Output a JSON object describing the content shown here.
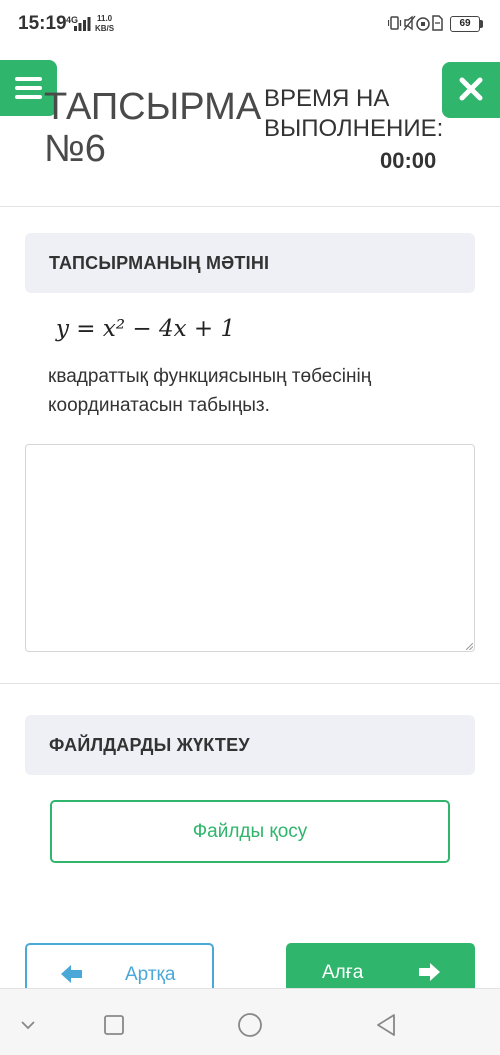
{
  "status_bar": {
    "time": "15:19",
    "network_type": "4G",
    "speed_value": "11.0",
    "speed_unit": "KB/S",
    "battery": "69",
    "icons": [
      "vibrate-icon",
      "mute-icon",
      "alarm-icon",
      "sim-icon"
    ]
  },
  "header": {
    "menu_icon": "hamburger-menu-icon",
    "close_icon": "close-icon",
    "task_title": "ТАПСЫРМА №6",
    "time_label": "ВРЕМЯ НА ВЫПОЛНЕНИЕ:",
    "time_value": "00:00"
  },
  "task": {
    "header": "ТАПСЫРМАНЫҢ МӘТІНІ",
    "formula": "y = x² − 4x + 1",
    "text": " квадраттық функциясының төбесінің координатасын табыңыз."
  },
  "answer": {
    "value": "",
    "placeholder": ""
  },
  "files": {
    "header": "ФАЙЛДАРДЫ ЖҮКТЕУ",
    "add_button": "Файлды қосу"
  },
  "navigation": {
    "back_label": "Артқа",
    "next_label": "Алға"
  },
  "android_nav": {
    "icons": [
      "down-chevron-icon",
      "square-recents-icon",
      "circle-home-icon",
      "triangle-back-icon"
    ]
  },
  "colors": {
    "accent_green": "#2fb56c",
    "accent_blue": "#4aa8d8",
    "section_bg": "#eef0f5"
  }
}
